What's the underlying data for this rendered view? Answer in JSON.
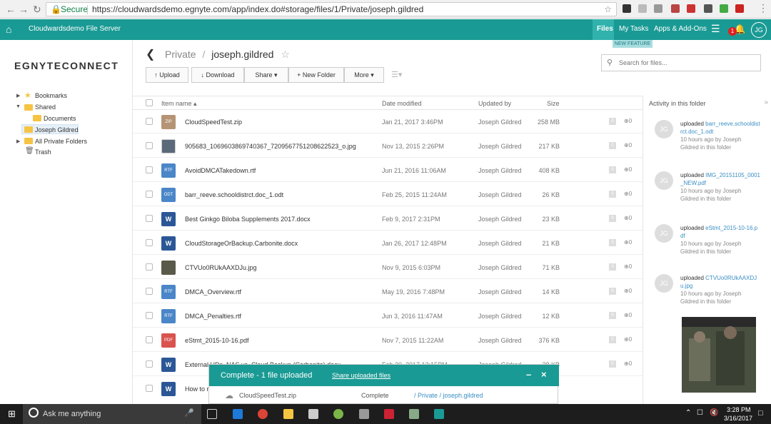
{
  "browser": {
    "secure_label": "Secure",
    "url": "https://cloudwardsdemo.egnyte.com/app/index.do#storage/files/1/Private/joseph.gildred"
  },
  "topbar": {
    "app_name": "Cloudwardsdemo File Server",
    "files_label": "Files",
    "tasks_label": "My Tasks",
    "apps_label": "Apps & Add-Ons",
    "notif_count": "1",
    "user_initials": "JG",
    "new_feature": "NEW FEATURE"
  },
  "sidebar": {
    "logo": "EGNYTECONNECT",
    "items": {
      "bookmarks": "Bookmarks",
      "shared": "Shared",
      "documents": "Documents",
      "joseph": "Joseph Gildred",
      "allprivate": "All Private Folders",
      "trash": "Trash"
    }
  },
  "breadcrumb": {
    "root": "Private",
    "sep": "/",
    "current": "joseph.gildred"
  },
  "toolbar": {
    "upload": "Upload",
    "download": "Download",
    "share": "Share",
    "newfolder": "New Folder",
    "more": "More"
  },
  "search": {
    "placeholder": "Search for files..."
  },
  "columns": {
    "name": "Item name",
    "date": "Date modified",
    "updated": "Updated by",
    "size": "Size"
  },
  "files": {
    "f0": {
      "name": "CloudSpeedTest.zip",
      "date": "Jan 21, 2017 3:46PM",
      "by": "Joseph Gildred",
      "size": "258 MB"
    },
    "f1": {
      "name": "905683_1069603869740367_7209567751208622523_o.jpg",
      "date": "Nov 13, 2015 2:26PM",
      "by": "Joseph Gildred",
      "size": "217 KB"
    },
    "f2": {
      "name": "AvoidDMCATakedown.rtf",
      "date": "Jun 21, 2016 11:06AM",
      "by": "Joseph Gildred",
      "size": "408 KB"
    },
    "f3": {
      "name": "barr_reeve.schooldistrct.doc_1.odt",
      "date": "Feb 25, 2015 11:24AM",
      "by": "Joseph Gildred",
      "size": "26 KB"
    },
    "f4": {
      "name": "Best Ginkgo Biloba Supplements 2017.docx",
      "date": "Feb 9, 2017 2:31PM",
      "by": "Joseph Gildred",
      "size": "23 KB"
    },
    "f5": {
      "name": "CloudStorageOrBackup.Carbonite.docx",
      "date": "Jan 26, 2017 12:48PM",
      "by": "Joseph Gildred",
      "size": "21 KB"
    },
    "f6": {
      "name": "CTVUo0RUkAAXDJu.jpg",
      "date": "Nov 9, 2015 6:03PM",
      "by": "Joseph Gildred",
      "size": "71 KB"
    },
    "f7": {
      "name": "DMCA_Overview.rtf",
      "date": "May 19, 2016 7:48PM",
      "by": "Joseph Gildred",
      "size": "14 KB"
    },
    "f8": {
      "name": "DMCA_Penalties.rtf",
      "date": "Jun 3, 2016 11:47AM",
      "by": "Joseph Gildred",
      "size": "12 KB"
    },
    "f9": {
      "name": "eStmt_2015-10-16.pdf",
      "date": "Nov 7, 2015 11:22AM",
      "by": "Joseph Gildred",
      "size": "376 KB"
    },
    "f10": {
      "name": "External HDs, NAS vs. Cloud Backup (Carbonite).docx",
      "date": "Feb 20, 2017 12:15PM",
      "by": "Joseph Gildred",
      "size": "28 KB"
    },
    "f11": {
      "name": "How to r",
      "date": "",
      "by": "",
      "size": ""
    }
  },
  "file_types": {
    "zip": "ZIP",
    "rtf": "RTF",
    "odt": "ODT",
    "docx": "W",
    "pdf": "PDF",
    "zero": "0"
  },
  "activity": {
    "title": "Activity in this folder",
    "verb": "uploaded",
    "user_initials": "JG",
    "meta": "10 hours ago by Joseph Gildred in this folder",
    "items": {
      "a0": "barr_reeve.schooldistrct.doc_1.odt",
      "a1": "IMG_20151105_0001_NEW.pdf",
      "a2": "eStmt_2015-10-16.pdf",
      "a3": "CTVUo0RUkAAXDJu.jpg"
    }
  },
  "upload_panel": {
    "title": "Complete - 1 file uploaded",
    "share_link": "Share uploaded files",
    "file": "CloudSpeedTest.zip",
    "status": "Complete",
    "path": "/ Private / joseph.gildred"
  },
  "taskbar": {
    "search": "Ask me anything",
    "time": "3:28 PM",
    "date": "3/16/2017"
  },
  "colors": {
    "accent": "#1a9a94",
    "link": "#3a8fc4",
    "folder": "#f6c444"
  }
}
